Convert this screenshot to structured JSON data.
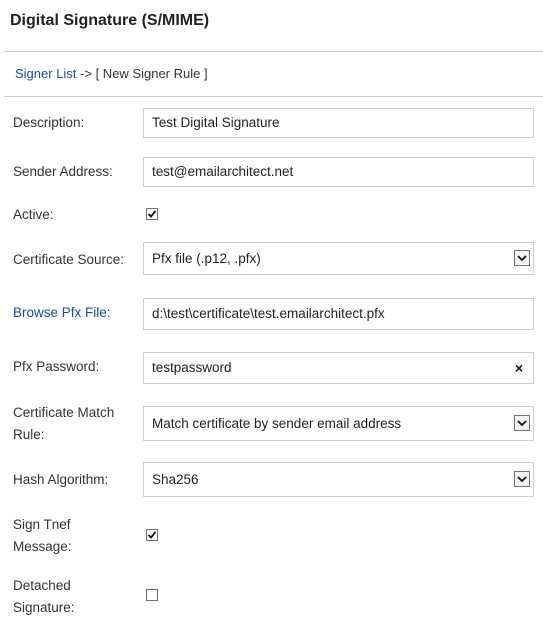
{
  "header": {
    "title": "Digital Signature (S/MIME)"
  },
  "breadcrumb": {
    "link": "Signer List",
    "separator": " -> ",
    "current": "[ New Signer Rule ]"
  },
  "form": {
    "description": {
      "label": "Description:",
      "value": "Test Digital Signature"
    },
    "sender_address": {
      "label": "Sender Address:",
      "value": "test@emailarchitect.net"
    },
    "active": {
      "label": "Active:",
      "checked": true
    },
    "certificate_source": {
      "label": "Certificate Source:",
      "value": "Pfx file (.p12, .pfx)"
    },
    "browse_pfx": {
      "label": "Browse Pfx File:",
      "value": "d:\\test\\certificate\\test.emailarchitect.pfx"
    },
    "pfx_password": {
      "label": "Pfx Password:",
      "value": "testpassword",
      "clear_icon": "×"
    },
    "match_rule": {
      "label_line1": "Certificate Match",
      "label_line2": "Rule:",
      "value": "Match certificate by sender email address"
    },
    "hash_algorithm": {
      "label": "Hash Algorithm:",
      "value": "Sha256"
    },
    "sign_tnef": {
      "label_line1": "Sign Tnef",
      "label_line2": "Message:",
      "checked": true
    },
    "detached": {
      "label_line1": "Detached",
      "label_line2": "Signature:",
      "checked": false
    }
  }
}
